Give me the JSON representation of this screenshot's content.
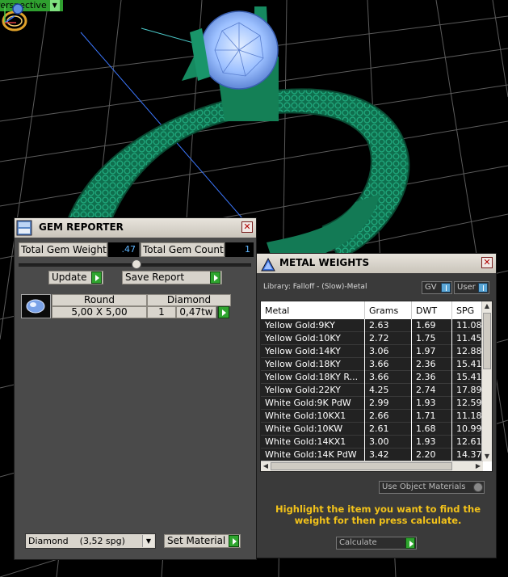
{
  "viewport": {
    "label": "Perspective",
    "colors": {
      "ring": "#157a57",
      "grid": "#6a6a6a",
      "gem": "#9bc4ff"
    }
  },
  "gem_reporter": {
    "title": "GEM REPORTER",
    "total_weight_label": "Total Gem Weight",
    "total_weight_value": ".47",
    "total_count_label": "Total Gem Count",
    "total_count_value": "1",
    "update_label": "Update",
    "save_report_label": "Save Report",
    "table": {
      "headers": [
        "Round",
        "Diamond"
      ],
      "row": {
        "size": "5,00 X 5,00",
        "count": "1",
        "weight": "0,47tw"
      }
    },
    "material_select": "Diamond    (3,52 spg)",
    "set_material_label": "Set Material"
  },
  "metal_weights": {
    "title": "METAL WEIGHTS",
    "library_label": "Library: Falloff - (Slow)-Metal",
    "gv_label": "GV",
    "user_label": "User",
    "columns": [
      "Metal",
      "Grams",
      "DWT",
      "SPG"
    ],
    "rows": [
      [
        "Yellow Gold:9KY",
        "2.63",
        "1.69",
        "11.08"
      ],
      [
        "Yellow Gold:10KY",
        "2.72",
        "1.75",
        "11.45"
      ],
      [
        "Yellow Gold:14KY",
        "3.06",
        "1.97",
        "12.88"
      ],
      [
        "Yellow Gold:18KY",
        "3.66",
        "2.36",
        "15.41"
      ],
      [
        "Yellow Gold:18KY R...",
        "3.66",
        "2.36",
        "15.41"
      ],
      [
        "Yellow Gold:22KY",
        "4.25",
        "2.74",
        "17.89"
      ],
      [
        "White Gold:9K PdW",
        "2.99",
        "1.93",
        "12.59"
      ],
      [
        "White Gold:10KX1",
        "2.66",
        "1.71",
        "11.18"
      ],
      [
        "White Gold:10KW",
        "2.61",
        "1.68",
        "10.99"
      ],
      [
        "White Gold:14KX1",
        "3.00",
        "1.93",
        "12.61"
      ],
      [
        "White Gold:14K PdW",
        "3.42",
        "2.20",
        "14.37"
      ]
    ],
    "use_object_label": "Use Object Materials",
    "hint": "Highlight the item you want to find the weight for then press calculate.",
    "calculate_label": "Calculate"
  }
}
